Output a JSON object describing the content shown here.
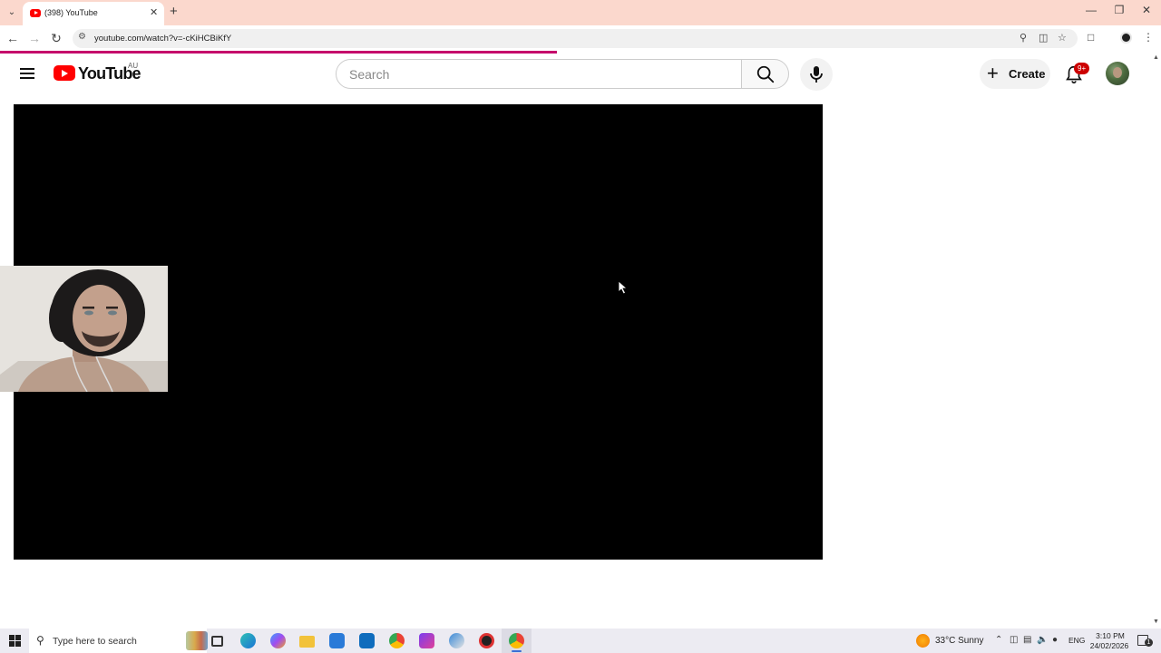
{
  "browser": {
    "tab_title": "(398) YouTube",
    "url": "youtube.com/watch?v=-cKiHCBiKfY",
    "page_load_progress": 0.48
  },
  "youtube": {
    "logo_text": "YouTube",
    "country_code": "AU",
    "search_placeholder": "Search",
    "create_label": "Create",
    "notification_count": "9+"
  },
  "taskbar": {
    "search_placeholder": "Type here to search",
    "weather": "33°C  Sunny",
    "language": "ENG",
    "time": "3:10 PM",
    "date": "24/02/2026",
    "notification_center_count": "1"
  },
  "colors": {
    "tabstrip_bg": "#fbd8cd",
    "youtube_red": "#ff0000",
    "load_bar": "#c5066b",
    "player_bg": "#000000"
  }
}
